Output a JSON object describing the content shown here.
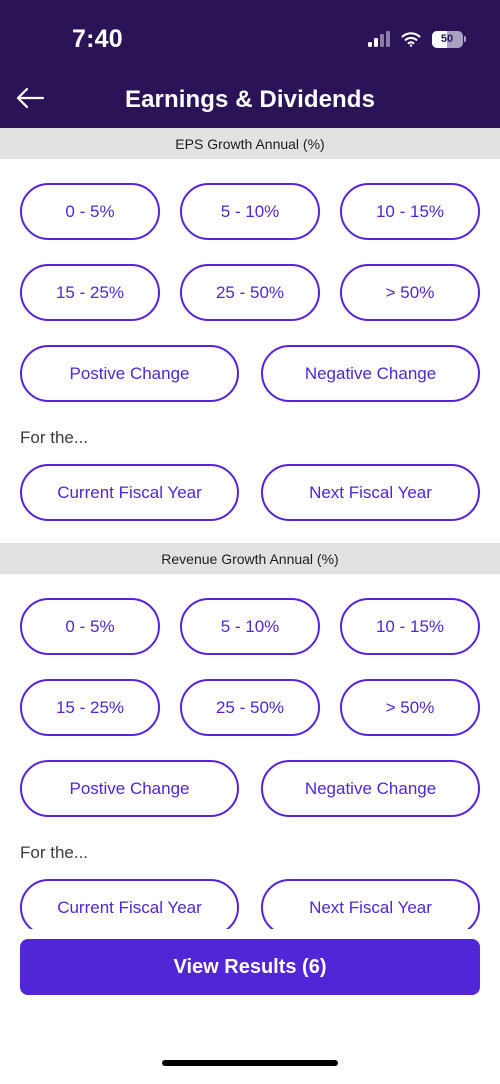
{
  "status_bar": {
    "time": "7:40",
    "battery_level": "50",
    "signal_icon": "cellular-signal-icon",
    "wifi_icon": "wifi-icon",
    "battery_icon": "battery-icon"
  },
  "app_bar": {
    "back_icon": "back-arrow-icon",
    "title": "Earnings & Dividends"
  },
  "sections": [
    {
      "header": "EPS Growth Annual (%)",
      "range_row_1": [
        "0 - 5%",
        "5 - 10%",
        "10 - 15%"
      ],
      "range_row_2": [
        "15 - 25%",
        "25 - 50%",
        "> 50%"
      ],
      "change_row": [
        "Postive Change",
        "Negative Change"
      ],
      "for_the_label": "For the...",
      "fiscal_row": [
        "Current Fiscal Year",
        "Next Fiscal Year"
      ]
    },
    {
      "header": "Revenue Growth Annual (%)",
      "range_row_1": [
        "0 - 5%",
        "5 - 10%",
        "10 - 15%"
      ],
      "range_row_2": [
        "15 - 25%",
        "25 - 50%",
        "> 50%"
      ],
      "change_row": [
        "Postive Change",
        "Negative Change"
      ],
      "for_the_label": "For the...",
      "fiscal_row": [
        "Current Fiscal Year",
        "Next Fiscal Year"
      ]
    }
  ],
  "cta": {
    "label": "View Results (6)"
  },
  "colors": {
    "header_navy": "#2a1457",
    "accent_purple": "#5026d6",
    "chip_border": "#5522dd",
    "section_gray": "#e2e2e2"
  }
}
